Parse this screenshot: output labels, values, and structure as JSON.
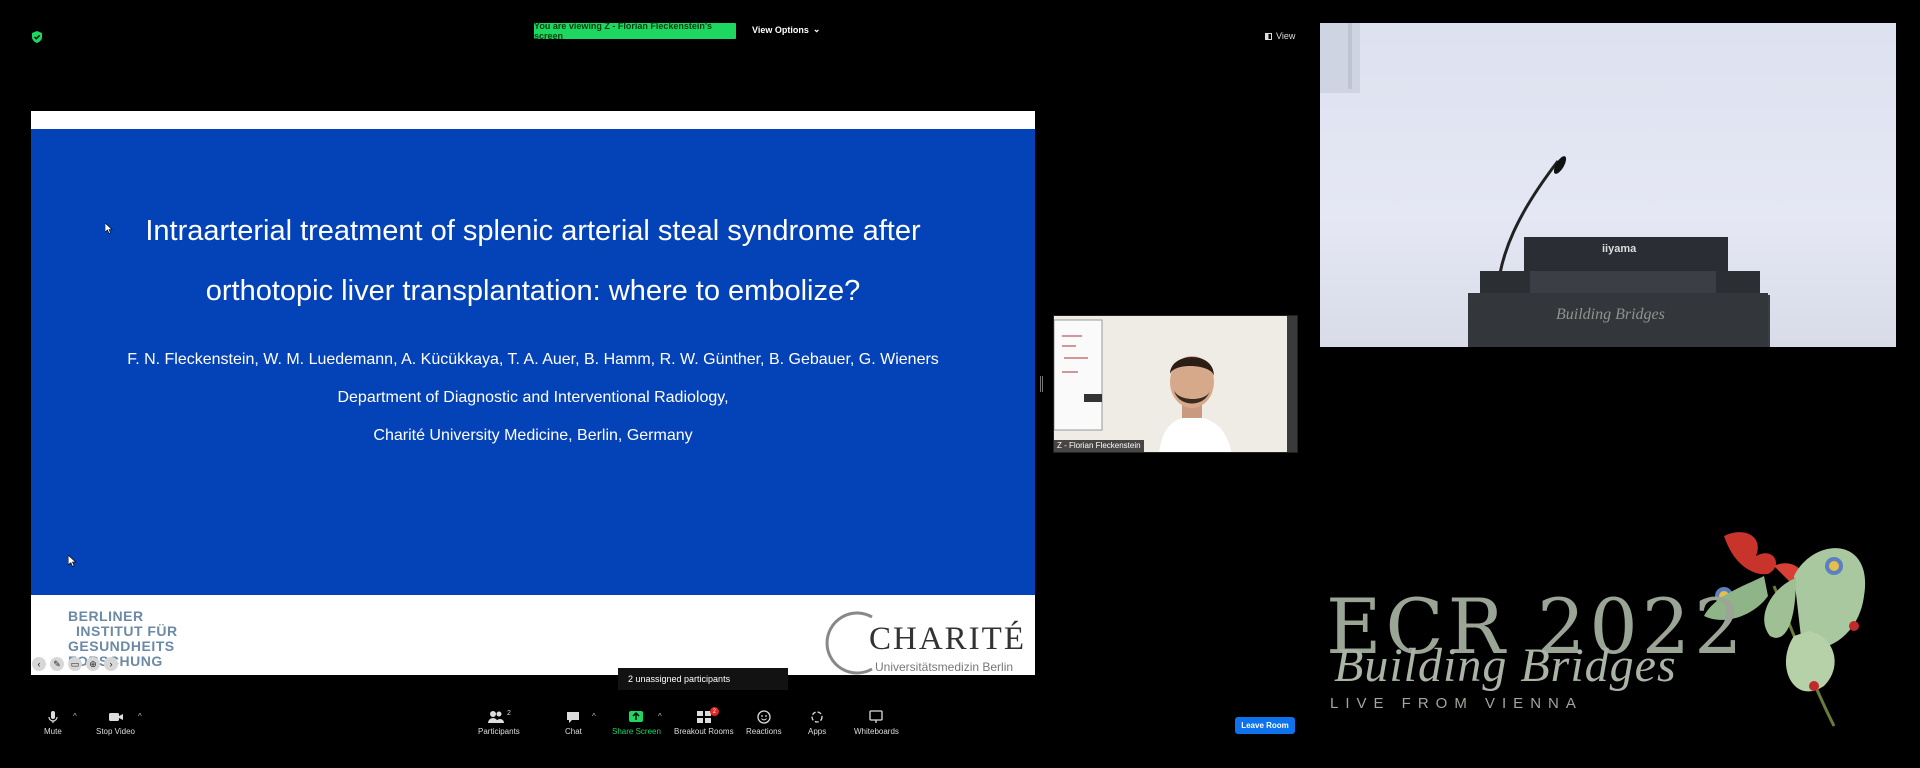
{
  "meeting": {
    "viewing_banner": "You are viewing Z - Florian Fleckenstein's screen",
    "view_options_label": "View Options",
    "view_label": "View",
    "unassigned_text": "2 unassigned participants"
  },
  "slide": {
    "title_line1": "Intraarterial treatment of splenic arterial steal syndrome after",
    "title_line2": "orthotopic liver transplantation: where to embolize?",
    "authors": "F. N. Fleckenstein, W. M. Luedemann, A. Kücükkaya, T. A. Auer, B. Hamm, R. W. Günther, B. Gebauer, G. Wieners",
    "department": "Department of Diagnostic and Interventional Radiology,",
    "university": "Charité University Medicine, Berlin, Germany",
    "bih_logo_lines": [
      "BERLINER",
      "INSTITUT FÜR",
      "GESUNDHEITS",
      "FORSCHUNG"
    ],
    "charite_logo": "CHARITÉ",
    "charite_sub": "Universitätsmedizin Berlin"
  },
  "participant": {
    "name": "Z - Florian Fleckenstein"
  },
  "toolbar": {
    "mute": "Mute",
    "stop_video": "Stop Video",
    "participants": "Participants",
    "participants_count": "2",
    "chat": "Chat",
    "share_screen": "Share Screen",
    "breakout_rooms": "Breakout Rooms",
    "breakout_badge": "2",
    "reactions": "Reactions",
    "apps": "Apps",
    "whiteboards": "Whiteboards",
    "leave_room": "Leave Room"
  },
  "stage": {
    "podium_brand": "iiyama",
    "podium_text": "Building Bridges"
  },
  "ecr": {
    "title": "ECR 2022",
    "script": "Building Bridges",
    "live": "LIVE FROM VIENNA"
  },
  "colors": {
    "slide_blue": "#0442b8",
    "banner_green": "#1ed760",
    "leave_blue": "#0e72ed"
  }
}
